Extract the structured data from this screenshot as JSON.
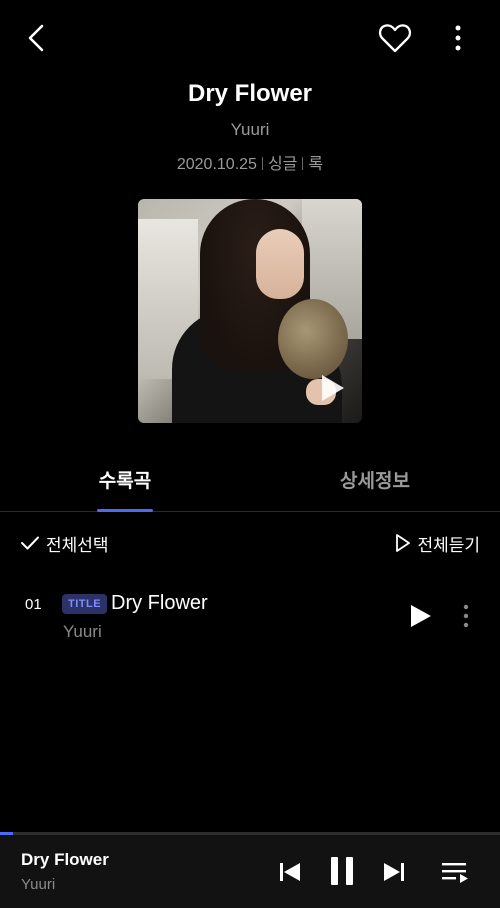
{
  "header": {
    "back_icon": "chevron-left-icon",
    "like_icon": "heart-outline-icon",
    "more_icon": "vertical-dots-icon"
  },
  "album": {
    "title": "Dry Flower",
    "artist": "Yuuri",
    "release_date": "2020.10.25",
    "type": "싱글",
    "genre": "록",
    "cover_icon": "play-icon"
  },
  "tabs": [
    {
      "label": "수록곡",
      "active": true
    },
    {
      "label": "상세정보",
      "active": false
    }
  ],
  "actions": {
    "select_all_label": "전체선택",
    "play_all_label": "전체듣기"
  },
  "tracks": [
    {
      "number": "01",
      "badge": "TITLE",
      "title": "Dry Flower",
      "artist": "Yuuri"
    }
  ],
  "player": {
    "title": "Dry Flower",
    "artist": "Yuuri",
    "progress": 0.025
  },
  "colors": {
    "accent": "#4d6af5",
    "background": "#000000",
    "secondary_text": "#9a9a9a",
    "badge_bg": "#2c3166",
    "badge_text": "#7f8dff"
  }
}
